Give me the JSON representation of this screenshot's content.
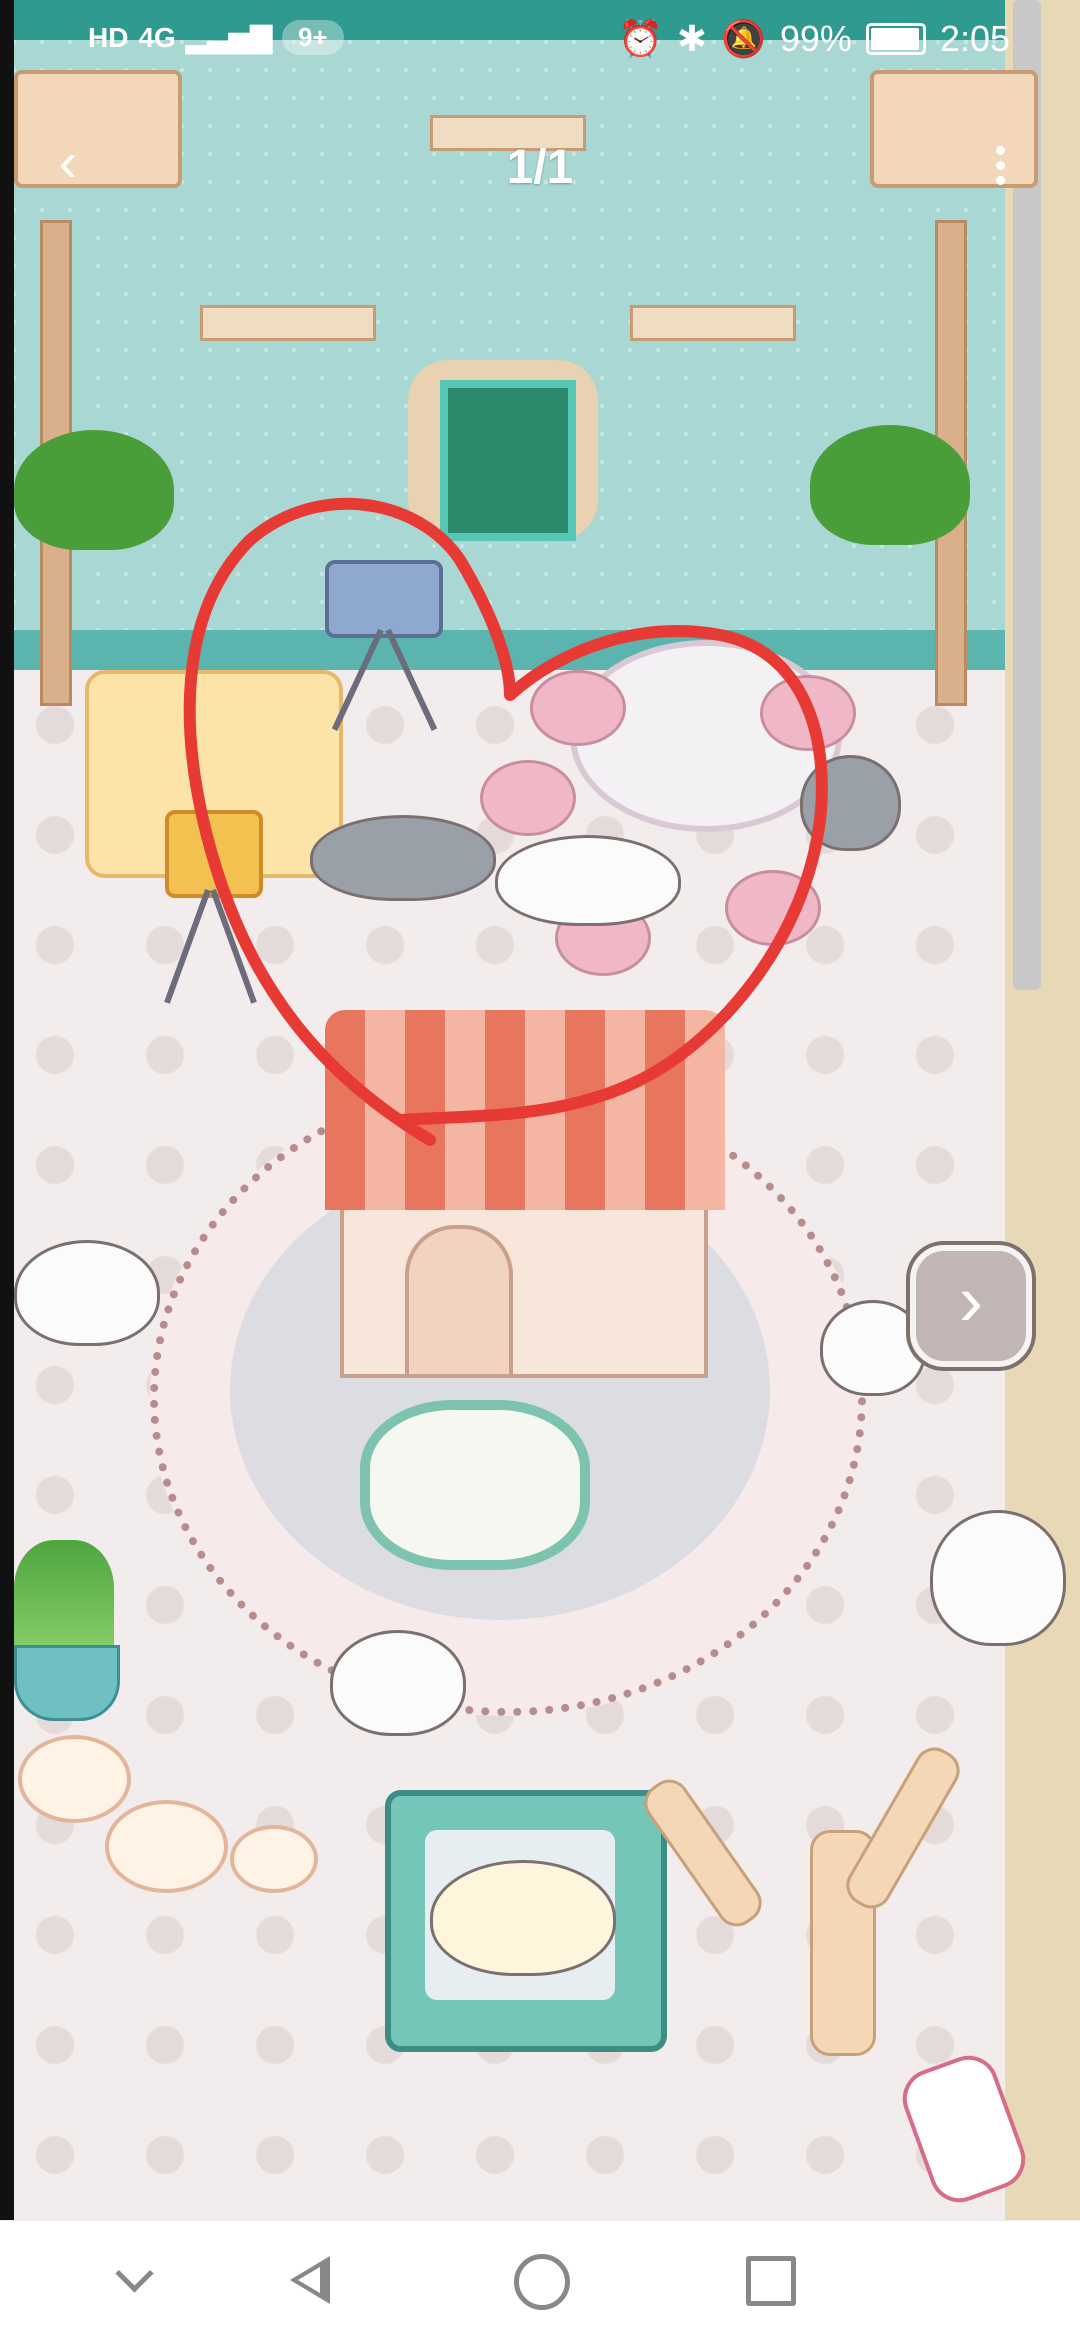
{
  "status_bar": {
    "network": "HD",
    "signal": "4G",
    "notification_count": "9+",
    "battery_percent": "99%",
    "time": "2:05",
    "icons": [
      "alarm-icon",
      "bluetooth-icon",
      "mute-icon",
      "battery-icon"
    ]
  },
  "viewer": {
    "counter": "1/1",
    "back_icon": "chevron-left-icon",
    "more_icon": "more-vertical-icon"
  },
  "scene": {
    "description_icons": [
      "heart-annotation",
      "next-arrow-icon"
    ],
    "annotation_color": "#e83a35"
  },
  "nav_bar": {
    "icons": [
      "chevron-down-icon",
      "back-triangle-icon",
      "home-circle-icon",
      "recents-square-icon"
    ]
  }
}
